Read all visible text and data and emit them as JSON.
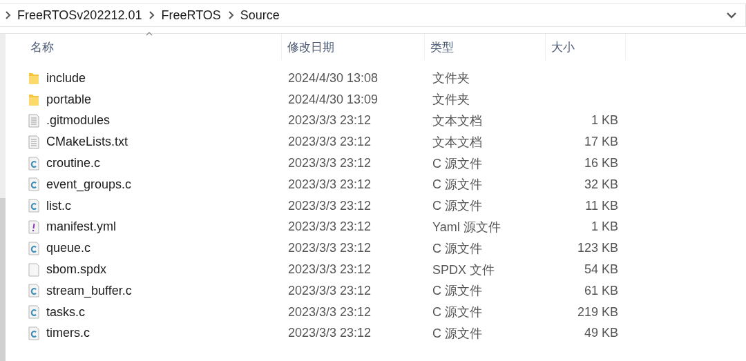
{
  "address_bar": {
    "path": [
      {
        "label": "FreeRTOSv202212.01"
      },
      {
        "label": "FreeRTOS"
      },
      {
        "label": "Source"
      }
    ]
  },
  "table": {
    "columns": [
      {
        "label": "名称",
        "sorted": true
      },
      {
        "label": "修改日期",
        "sorted": false
      },
      {
        "label": "类型",
        "sorted": false
      },
      {
        "label": "大小",
        "sorted": false
      }
    ],
    "rows": [
      {
        "kind": "folder",
        "name": "include",
        "date": "2024/4/30 13:08",
        "type": "文件夹"
      },
      {
        "kind": "folder",
        "name": "portable",
        "date": "2024/4/30 13:09",
        "type": "文件夹"
      },
      {
        "kind": "text",
        "name": ".gitmodules",
        "date": "2023/3/3 23:12",
        "type": "文本文档",
        "size": "1 KB"
      },
      {
        "kind": "text",
        "name": "CMakeLists.txt",
        "date": "2023/3/3 23:12",
        "type": "文本文档",
        "size": "17 KB"
      },
      {
        "kind": "c",
        "name": "croutine.c",
        "date": "2023/3/3 23:12",
        "type": "C 源文件",
        "size": "16 KB"
      },
      {
        "kind": "c",
        "name": "event_groups.c",
        "date": "2023/3/3 23:12",
        "type": "C 源文件",
        "size": "32 KB"
      },
      {
        "kind": "c",
        "name": "list.c",
        "date": "2023/3/3 23:12",
        "type": "C 源文件",
        "size": "11 KB"
      },
      {
        "kind": "yaml",
        "name": "manifest.yml",
        "date": "2023/3/3 23:12",
        "type": "Yaml 源文件",
        "size": "1 KB"
      },
      {
        "kind": "c",
        "name": "queue.c",
        "date": "2023/3/3 23:12",
        "type": "C 源文件",
        "size": "123 KB"
      },
      {
        "kind": "blank",
        "name": "sbom.spdx",
        "date": "2023/3/3 23:12",
        "type": "SPDX 文件",
        "size": "54 KB"
      },
      {
        "kind": "c",
        "name": "stream_buffer.c",
        "date": "2023/3/3 23:12",
        "type": "C 源文件",
        "size": "61 KB"
      },
      {
        "kind": "c",
        "name": "tasks.c",
        "date": "2023/3/3 23:12",
        "type": "C 源文件",
        "size": "219 KB"
      },
      {
        "kind": "c",
        "name": "timers.c",
        "date": "2023/3/3 23:12",
        "type": "C 源文件",
        "size": "49 KB"
      }
    ]
  }
}
